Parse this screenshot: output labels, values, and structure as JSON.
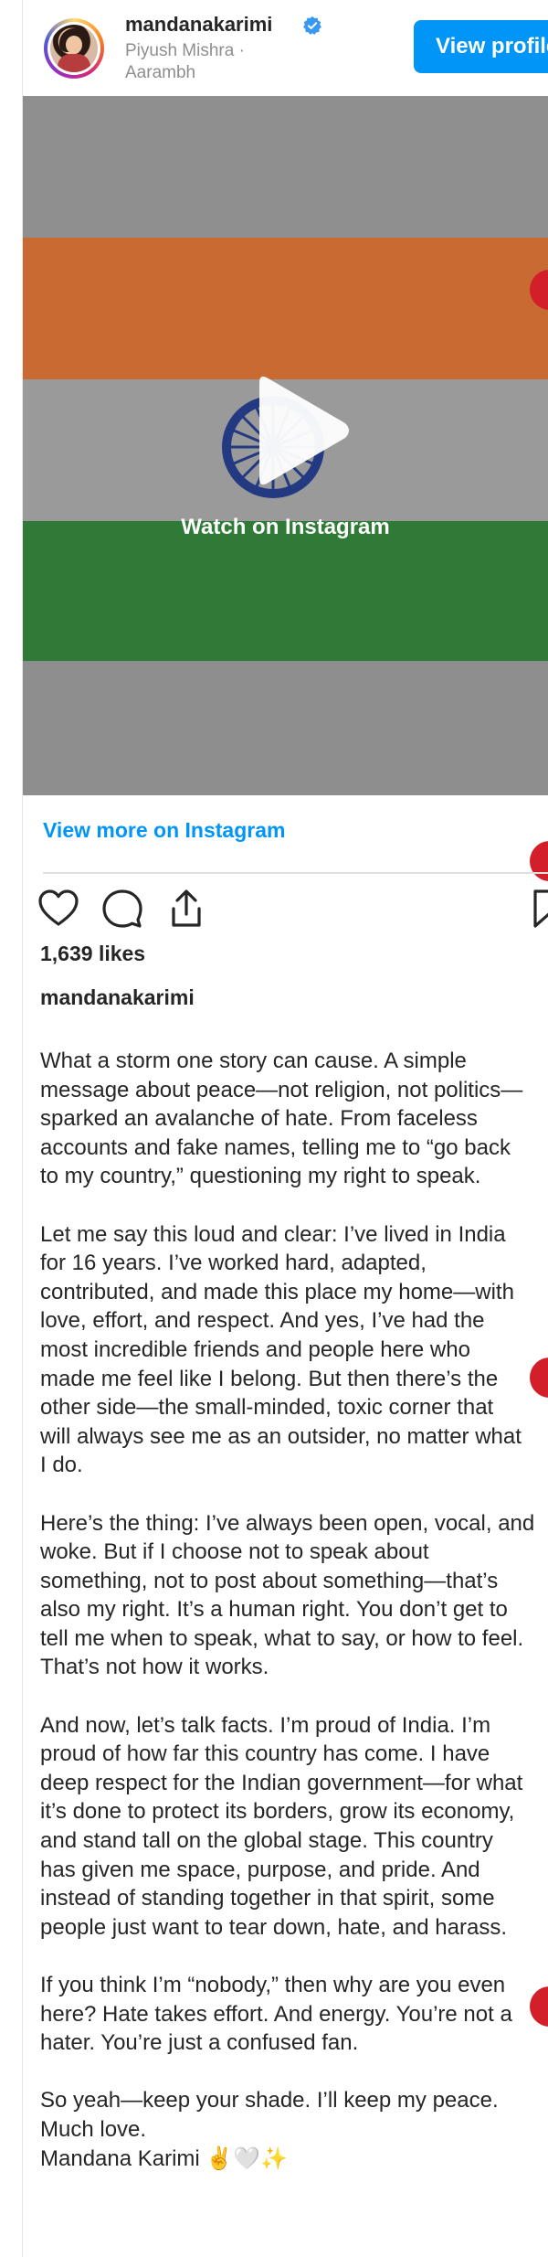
{
  "header": {
    "username": "mandanakarimi",
    "subtitle_line1": "Piyush Mishra ·",
    "subtitle_line2": "Aarambh",
    "view_profile_label": "View profile",
    "verified_icon": "verified-badge-icon"
  },
  "video": {
    "watch_label": "Watch on Instagram",
    "play_icon": "play-icon"
  },
  "post": {
    "view_more_label": "View more on Instagram",
    "icons": [
      "heart-icon",
      "comment-icon",
      "share-icon",
      "bookmark-icon"
    ],
    "likes": "1,639 likes",
    "caption_user": "mandanakarimi",
    "caption_paragraphs": [
      [
        "What a storm one story can cause. A simple",
        "message about peace—not religion, not politics—",
        "sparked an avalanche of hate. From faceless",
        "accounts and fake names, telling me to “go back",
        "to my country,” questioning my right to speak."
      ],
      [
        "Let me say this loud and clear: I’ve lived in India",
        "for 16 years. I’ve worked hard, adapted,",
        "contributed, and made this place my home—with",
        "love, effort, and respect. And yes, I’ve had the",
        "most incredible friends and people here who",
        "made me feel like I belong. But then there’s the",
        "other side—the small-minded, toxic corner that",
        "will always see me as an outsider, no matter what",
        "I do."
      ],
      [
        "Here’s the thing: I’ve always been open, vocal, and",
        "woke. But if I choose not to speak about",
        "something, not to post about something—that’s",
        "also my right. It’s a human right. You don’t get to",
        "tell me when to speak, what to say, or how to feel.",
        "That’s not how it works."
      ],
      [
        "And now, let’s talk facts. I’m proud of India. I’m",
        "proud of how far this country has come. I have",
        "deep respect for the Indian government—for what",
        "it’s done to protect its borders, grow its economy,",
        "and stand tall on the global stage. This country",
        "has given me space, purpose, and pride. And",
        "instead of standing together in that spirit, some",
        "people just want to tear down, hate, and harass."
      ],
      [
        "If you think I’m “nobody,” then why are you even",
        "here? Hate takes effort. And energy. You’re not a",
        "hater. You’re just a confused fan."
      ],
      [
        "So yeah—keep your shade. I’ll keep my peace.",
        "Much love.",
        "Mandana Karimi ✌️🤍✨"
      ]
    ]
  },
  "colors": {
    "accent": "#0095f6",
    "text": "#262626",
    "muted": "#8e8e8e",
    "saffron": "#c96a32",
    "green": "#2f7a37"
  }
}
